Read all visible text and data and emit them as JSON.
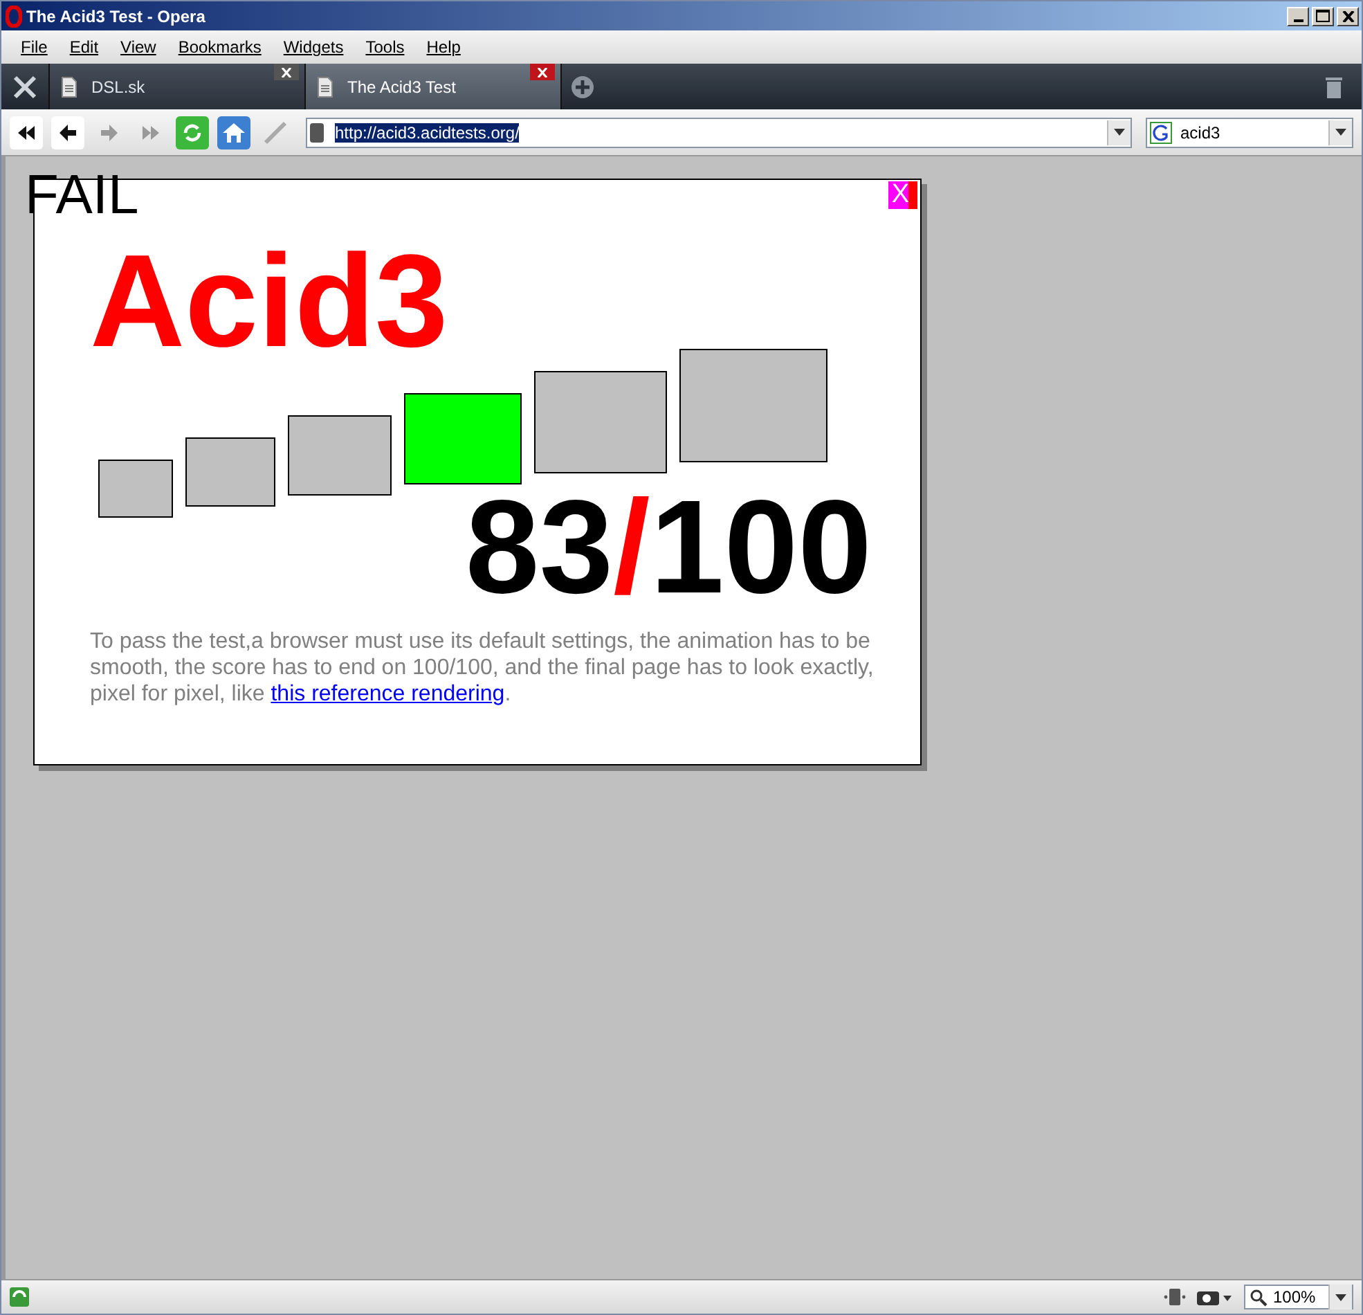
{
  "window": {
    "title": "The Acid3 Test - Opera"
  },
  "menu": [
    "File",
    "Edit",
    "View",
    "Bookmarks",
    "Widgets",
    "Tools",
    "Help"
  ],
  "tabs": [
    {
      "label": "DSL.sk",
      "selected": false
    },
    {
      "label": "The Acid3 Test",
      "selected": true
    }
  ],
  "address": {
    "value": "http://acid3.acidtests.org/"
  },
  "search": {
    "value": "acid3"
  },
  "page": {
    "status": "FAIL",
    "title": "Acid3",
    "buckets": [
      {
        "color": "#c0c0c0"
      },
      {
        "color": "#c0c0c0"
      },
      {
        "color": "#c0c0c0"
      },
      {
        "color": "#00ff00"
      },
      {
        "color": "#c0c0c0"
      },
      {
        "color": "#c0c0c0"
      }
    ],
    "score": "83",
    "separator": "/",
    "total": "100",
    "close": "X",
    "text": "To pass the test,a browser must use its default settings, the animation has to be smooth, the score has to end on 100/100, and the final page has to look exactly, pixel for pixel, like ",
    "link": "this reference rendering",
    "text_end": "."
  },
  "status_bar": {
    "zoom": "100%"
  }
}
